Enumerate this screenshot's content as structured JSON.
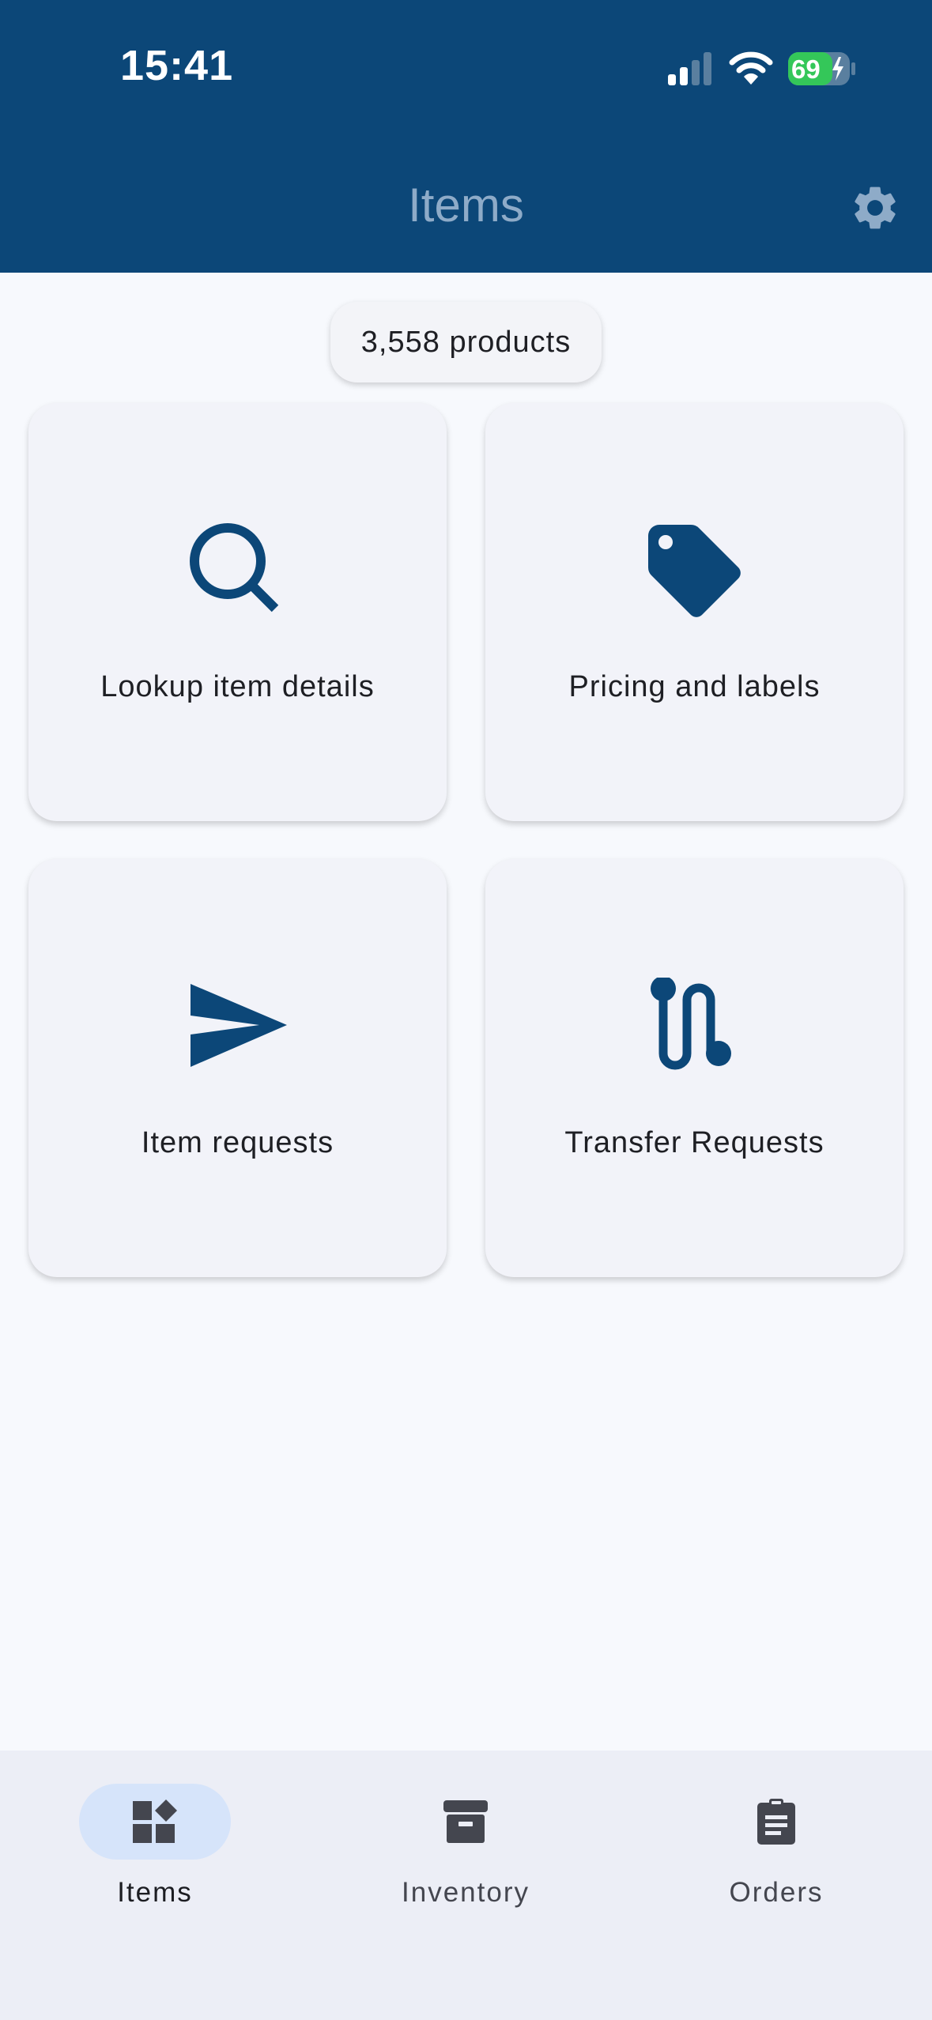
{
  "status_bar": {
    "time": "15:41",
    "battery_level": "69",
    "battery_color": "#34c759"
  },
  "header": {
    "title": "Items",
    "settings_icon": "gear-icon",
    "background": "#0c4778"
  },
  "summary": {
    "products_label": "3,558 products"
  },
  "cards": [
    {
      "label": "Lookup item details",
      "icon": "search-icon"
    },
    {
      "label": "Pricing and labels",
      "icon": "tag-icon"
    },
    {
      "label": "Item requests",
      "icon": "send-icon"
    },
    {
      "label": "Transfer Requests",
      "icon": "route-icon"
    }
  ],
  "colors": {
    "accent": "#0c4778",
    "nav_active": "#d6e4fa"
  },
  "bottom_nav": {
    "items": [
      {
        "label": "Items",
        "icon": "widgets-icon",
        "active": true
      },
      {
        "label": "Inventory",
        "icon": "archive-box-icon",
        "active": false
      },
      {
        "label": "Orders",
        "icon": "clipboard-icon",
        "active": false
      }
    ]
  }
}
